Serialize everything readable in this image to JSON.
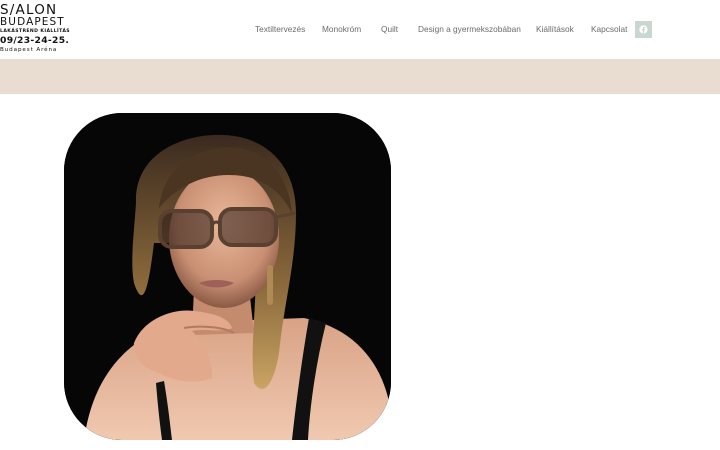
{
  "logo": {
    "line1": "S/ALON",
    "line2": "BUDAPEST",
    "line3": "LAKÁSTREND KIÁLLÍTÁS",
    "line4": "09/23-24-25.",
    "line5": "Budapest Aréna"
  },
  "nav": {
    "items": [
      {
        "label": "Textiltervezés"
      },
      {
        "label": "Monokróm"
      },
      {
        "label": "Quilt"
      },
      {
        "label": "Design a gyermekszobában"
      },
      {
        "label": "Kiállítások"
      },
      {
        "label": "Kapcsolat"
      }
    ],
    "social_icon": "facebook-icon",
    "social_bg": "#c8d8d0"
  },
  "colors": {
    "band": "#e9ddd2",
    "nav_text": "#6b6b6b"
  },
  "hero_image": {
    "subject": "portrait-photo"
  }
}
